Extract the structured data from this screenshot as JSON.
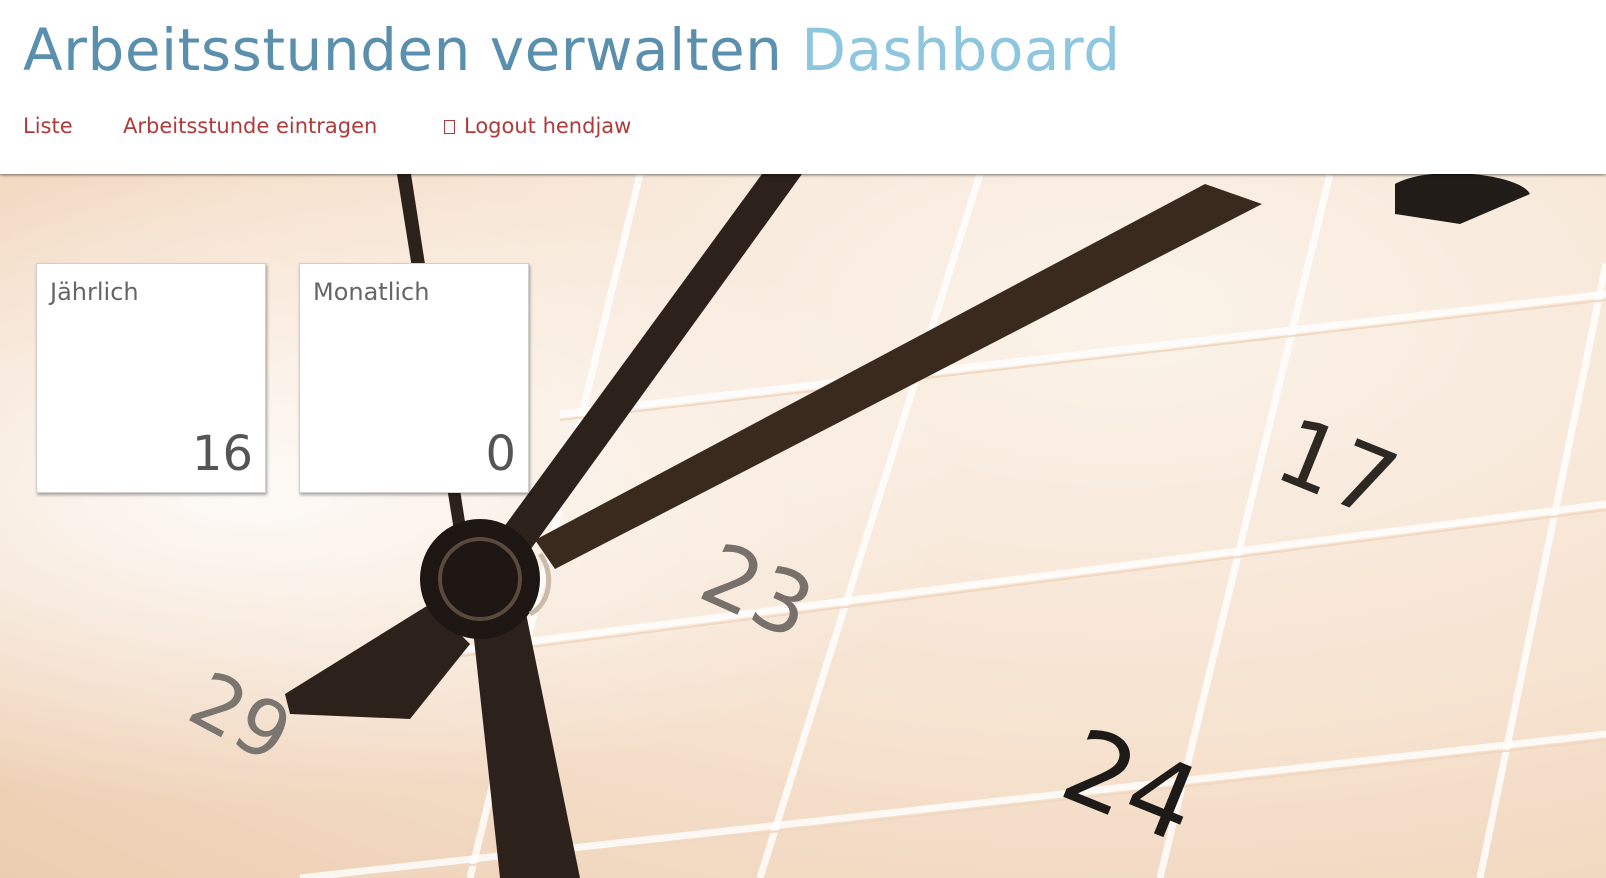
{
  "header": {
    "app_title": "Arbeitsstunden verwalten",
    "page_title": "Dashboard"
  },
  "nav": {
    "items": [
      {
        "label": "Liste"
      },
      {
        "label": "Arbeitsstunde eintragen"
      },
      {
        "label": "Logout hendjaw",
        "icon": "logout-icon"
      }
    ]
  },
  "cards": [
    {
      "label": "Jährlich",
      "value": "16"
    },
    {
      "label": "Monatlich",
      "value": "0"
    }
  ],
  "background": {
    "image": "clock-over-calendar",
    "calendar_numbers": [
      "29",
      "23",
      "17",
      "24"
    ]
  },
  "colors": {
    "app_title": "#5b8fae",
    "page_title": "#8ec5df",
    "nav_link": "#b03a3a"
  }
}
